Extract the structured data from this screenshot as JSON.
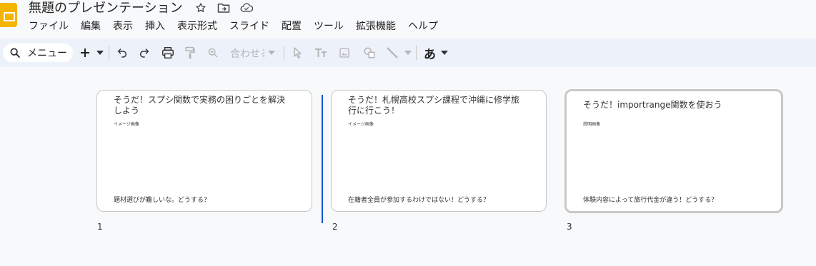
{
  "app": {
    "title": "無題のプレゼンテーション",
    "title_icons": [
      "star-icon",
      "move-to-folder-icon",
      "cloud-saved-icon"
    ]
  },
  "menu": [
    "ファイル",
    "編集",
    "表示",
    "挿入",
    "表示形式",
    "スライド",
    "配置",
    "ツール",
    "拡張機能",
    "ヘルプ"
  ],
  "toolbar": {
    "search_label": "メニュー",
    "zoom_label": "合わせる",
    "input_tool": "あ"
  },
  "slides": [
    {
      "number": "1",
      "title": "そうだ！スプシ関数で実務の困りごとを解決しよう",
      "subtitle": "イメージ画像",
      "bottom": "題材選びが難しいな。どうする？"
    },
    {
      "number": "2",
      "title": "そうだ！札幌高校スプシ課程で沖縄に修学旅行に行こう！",
      "subtitle": "イメージ画像",
      "bottom": "在籍者全員が参加するわけではない！どうする？"
    },
    {
      "number": "3",
      "title": "そうだ！importrange関数を使おう",
      "subtitle": "説明画像",
      "bottom": "体験内容によって旅行代金が違う！どうする？"
    }
  ],
  "colors": {
    "accent": "#0b57d0",
    "toolbar_bg": "#edf2fa",
    "logo": "#f4b400"
  }
}
